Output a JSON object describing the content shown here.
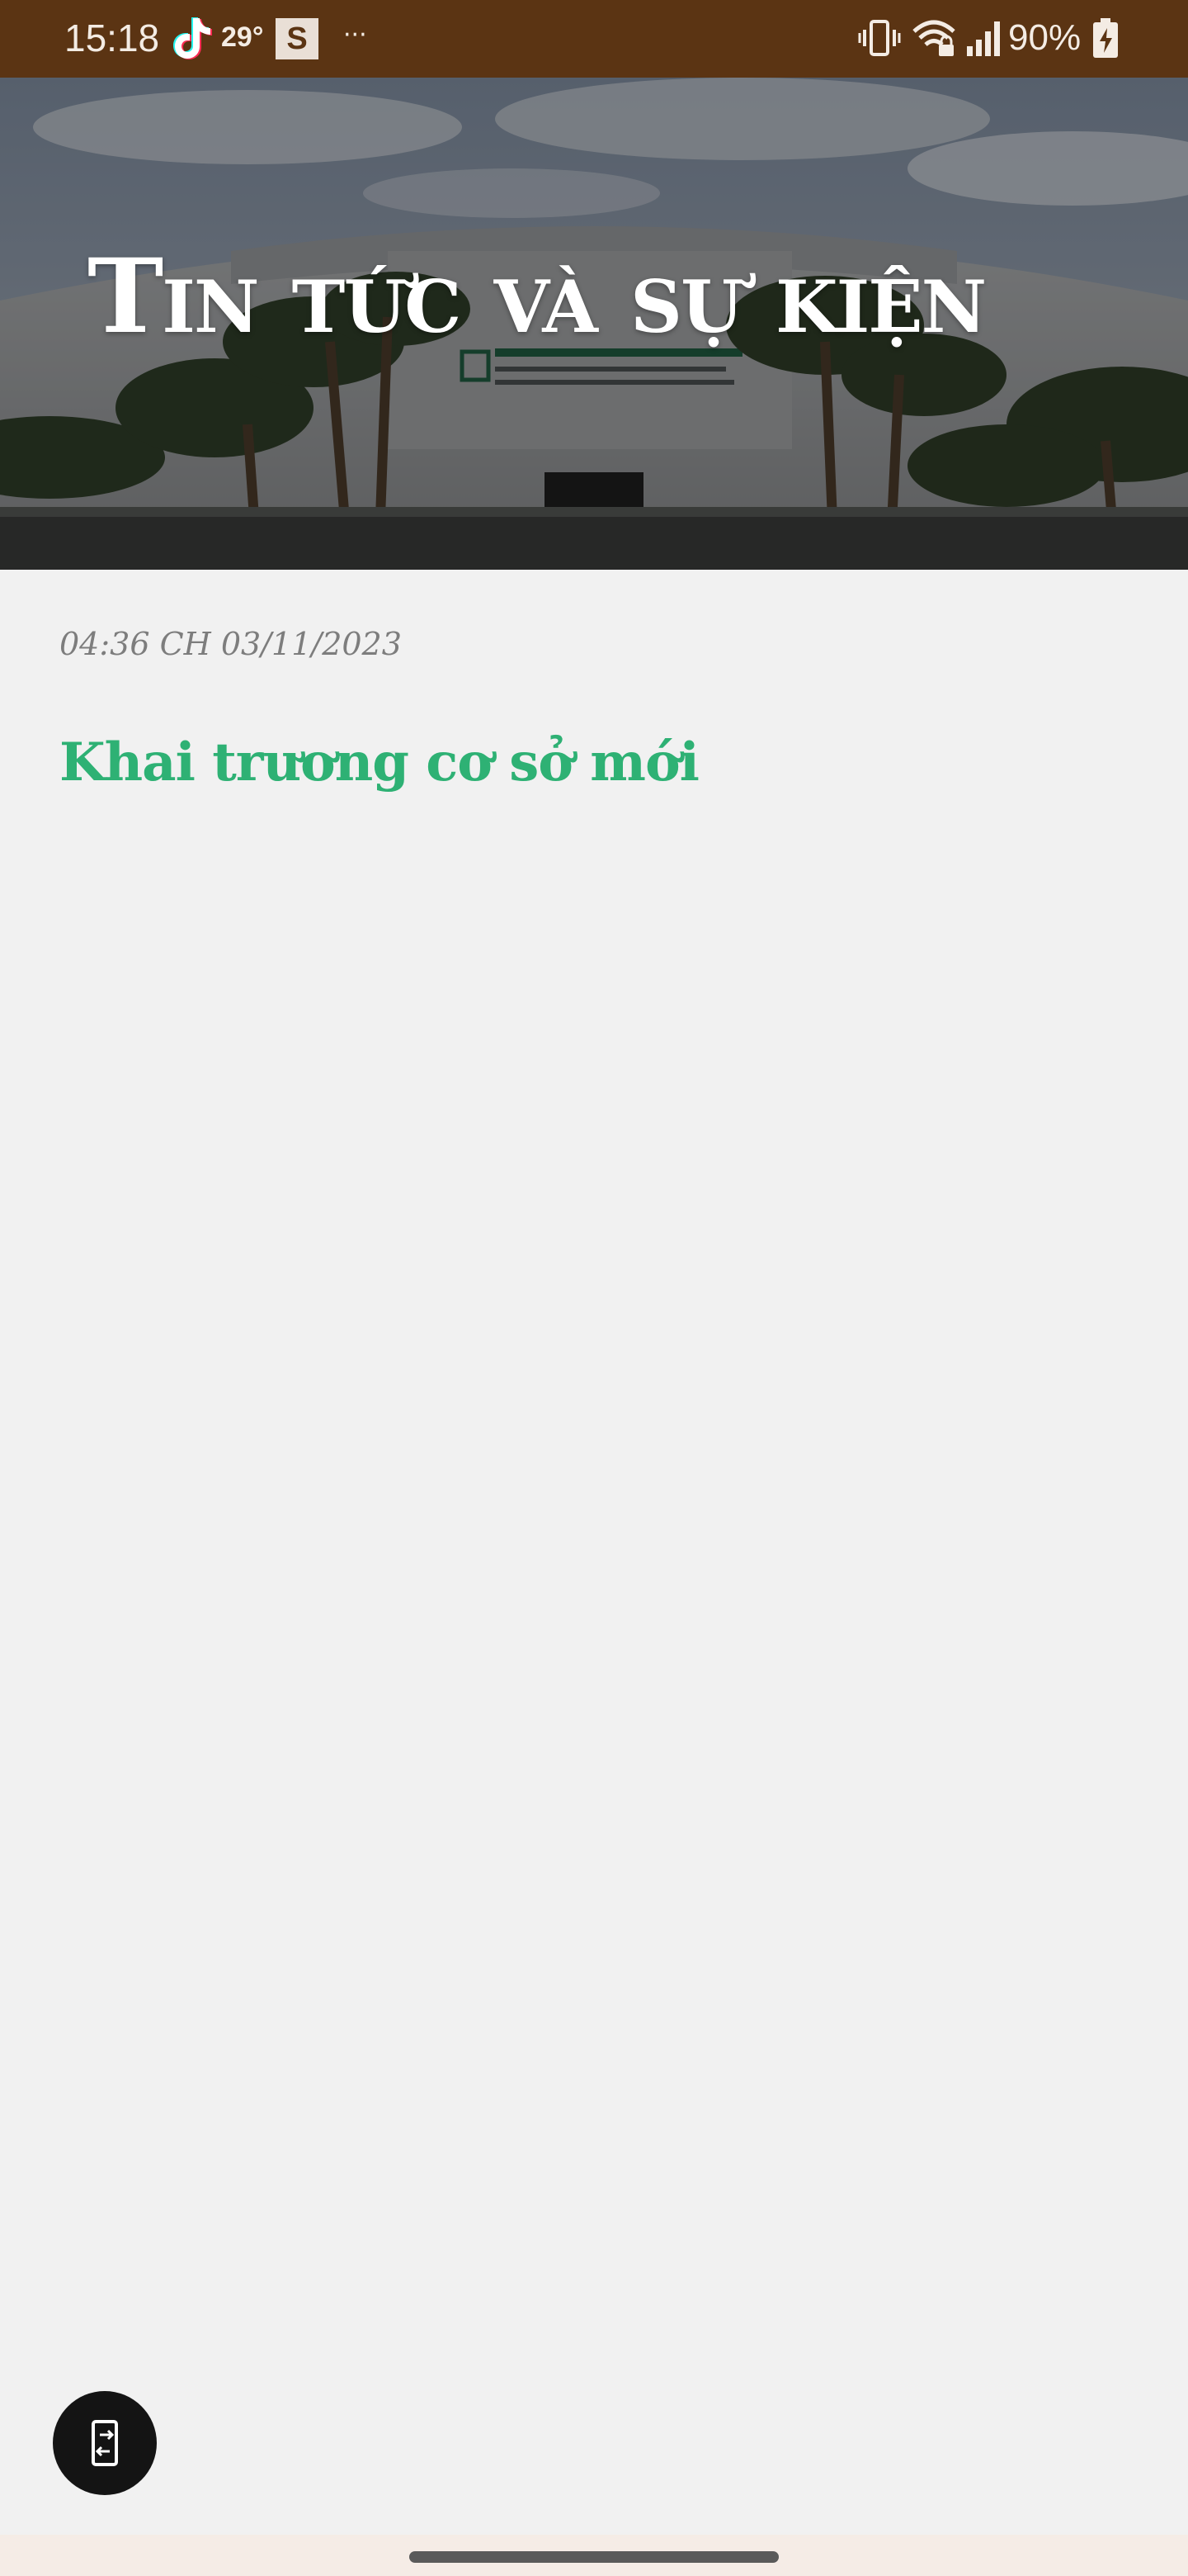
{
  "status_bar": {
    "time": "15:18",
    "temperature": "29°",
    "s_badge": "S",
    "more": "···",
    "battery": "90%",
    "icons": [
      "tiktok-icon",
      "vibrate-icon",
      "wifi-icon",
      "signal-icon",
      "battery-icon"
    ]
  },
  "hero": {
    "title": "Tin tức và sự kiện",
    "sign_lines": [
      "BẢO TÀNG DÂN TỘC HỌC VIỆT NAM",
      "VIETNAM MUSEUM OF ETHNOLOGY",
      "MUSÉE D'ETHNOGRAPHIE DU VIETNAM"
    ]
  },
  "post": {
    "date": "04:36 CH 03/11/2023",
    "title": "Khai trương cơ sở mới"
  },
  "fab": {
    "icon": "rotate-screen-icon"
  },
  "colors": {
    "status_bar": "#5b3413",
    "accent_green": "#2eb174",
    "background": "#f1f1f1",
    "date_gray": "#7d7d7d"
  }
}
